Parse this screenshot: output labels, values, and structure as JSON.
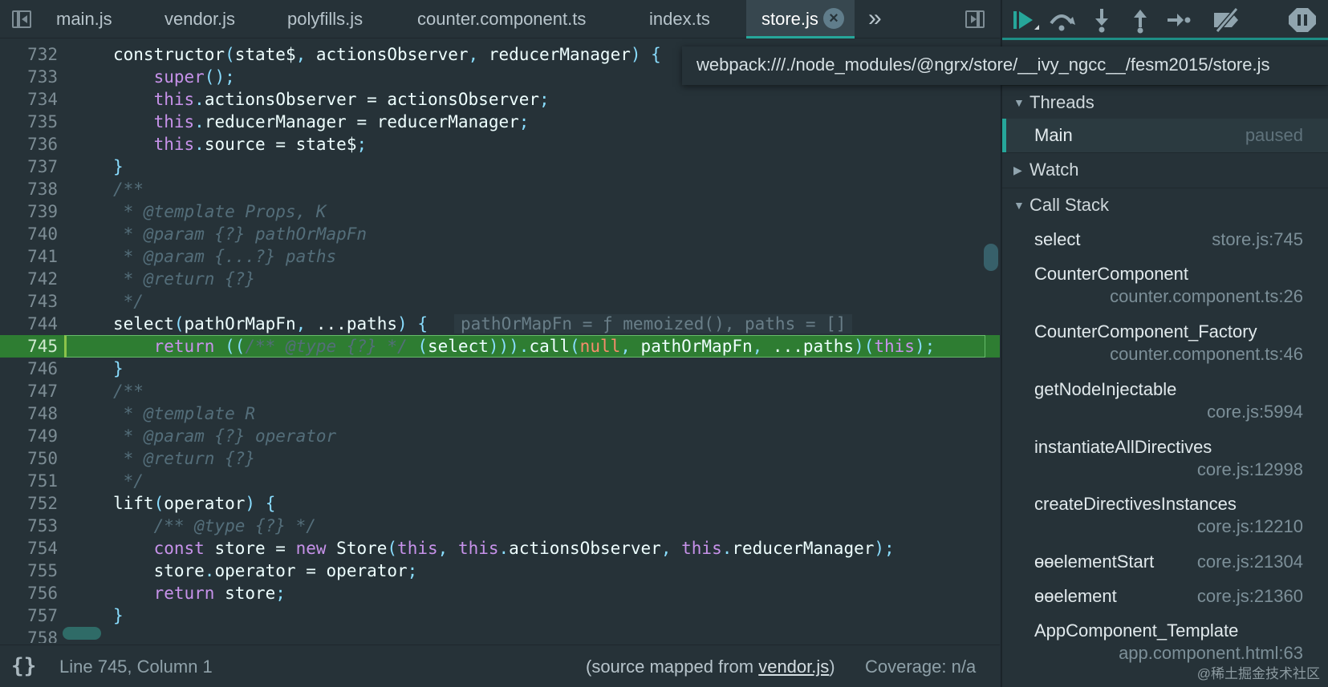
{
  "tabs": [
    {
      "label": "main.js"
    },
    {
      "label": "vendor.js"
    },
    {
      "label": "polyfills.js"
    },
    {
      "label": "counter.component.ts"
    },
    {
      "label": "index.ts"
    },
    {
      "label": "store.js",
      "active": true
    }
  ],
  "tooltip": {
    "path": "webpack:///./node_modules/@ngrx/store/__ivy_ngcc__/fesm2015/store.js"
  },
  "code": {
    "line_numbers": [
      "732",
      "733",
      "734",
      "735",
      "736",
      "737",
      "738",
      "739",
      "740",
      "741",
      "742",
      "743",
      "744",
      "745",
      "746",
      "747",
      "748",
      "749",
      "750",
      "751",
      "752",
      "753",
      "754",
      "755",
      "756",
      "757",
      "758"
    ],
    "execution_line": "745",
    "inline_value": "pathOrMapFn = ƒ memoized(), paths = []"
  },
  "status_bar": {
    "pretty_print": "{}",
    "cursor_position": "Line 745, Column 1",
    "source_mapped_prefix": "(source mapped from ",
    "source_mapped_file": "vendor.js",
    "source_mapped_suffix": ")",
    "coverage": "Coverage: n/a"
  },
  "debugger": {
    "toolbar": [
      "resume-icon",
      "step-over-icon",
      "step-into-icon",
      "step-out-icon",
      "step-icon",
      "deactivate-breakpoints-icon",
      "pause-on-exceptions-icon"
    ],
    "threads": {
      "title": "Threads",
      "main": {
        "name": "Main",
        "status": "paused"
      }
    },
    "watch": {
      "title": "Watch"
    },
    "call_stack": {
      "title": "Call Stack",
      "frames": [
        {
          "name": "select",
          "location": "store.js:745"
        },
        {
          "name": "CounterComponent",
          "location": "counter.component.ts:26"
        },
        {
          "name": "CounterComponent_Factory",
          "location": "counter.component.ts:46"
        },
        {
          "name": "getNodeInjectable",
          "location": "core.js:5994"
        },
        {
          "name": "instantiateAllDirectives",
          "location": "core.js:12998"
        },
        {
          "name": "createDirectivesInstances",
          "location": "core.js:12210"
        },
        {
          "name": "ɵɵelementStart",
          "location": "core.js:21304"
        },
        {
          "name": "ɵɵelement",
          "location": "core.js:21360"
        },
        {
          "name": "AppComponent_Template",
          "location": "app.component.html:63"
        }
      ]
    }
  },
  "watermark": "@稀土掘金技术社区",
  "colors": {
    "accent": "#26a69a",
    "exec_line": "#2e7d32",
    "keyword": "#c792ea",
    "function": "#82aaff",
    "comment": "#546e7a"
  }
}
